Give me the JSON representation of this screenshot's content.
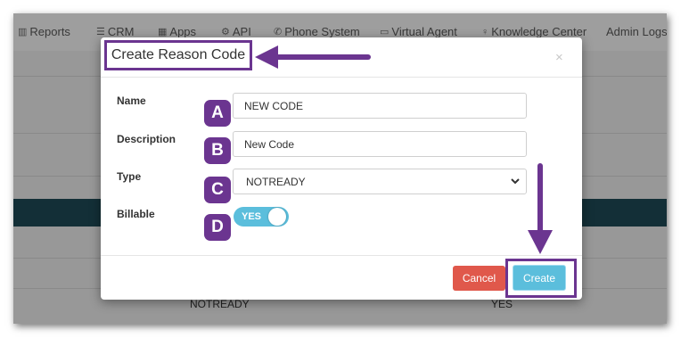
{
  "nav": {
    "reports": "Reports",
    "crm": "CRM",
    "apps": "Apps",
    "api": "API",
    "phone_system": "Phone System",
    "virtual_agent": "Virtual Agent",
    "knowledge_center": "Knowledge Center",
    "admin_logs": "Admin Logs"
  },
  "background_table": {
    "type_cell": "NOTREADY",
    "billable_cell": "YES"
  },
  "modal": {
    "title": "Create Reason Code",
    "close_glyph": "×",
    "fields": {
      "name_label": "Name",
      "name_value": "NEW CODE",
      "description_label": "Description",
      "description_value": "New Code",
      "type_label": "Type",
      "type_value": "NOTREADY",
      "billable_label": "Billable",
      "billable_value": "YES"
    },
    "buttons": {
      "cancel": "Cancel",
      "create": "Create"
    }
  },
  "annotations": {
    "badge_a": "A",
    "badge_b": "B",
    "badge_c": "C",
    "badge_d": "D",
    "color": "#6b3590"
  },
  "colors": {
    "cancel_button": "#e0584b",
    "create_button": "#5bbedc",
    "toggle_on": "#5bbedc",
    "header_band": "#1d4652"
  }
}
